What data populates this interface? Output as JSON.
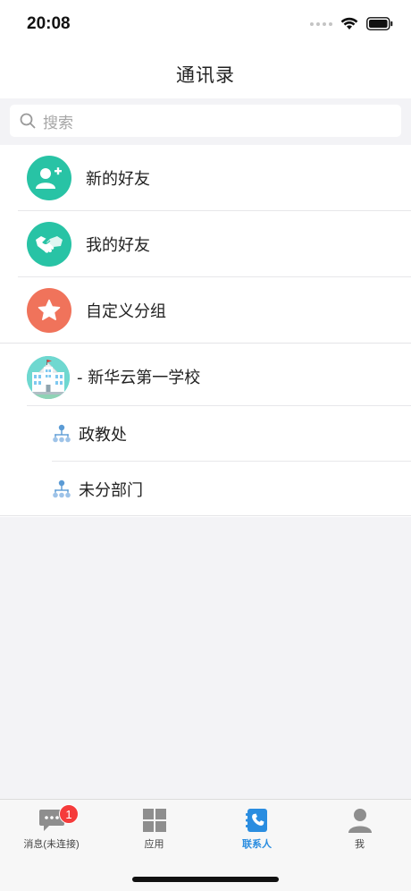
{
  "status_bar": {
    "time": "20:08"
  },
  "nav": {
    "title": "通讯录"
  },
  "search": {
    "placeholder": "搜索"
  },
  "contacts": {
    "items": [
      {
        "label": "新的好友",
        "icon": "add-user-icon",
        "color": "#28c3a5"
      },
      {
        "label": "我的好友",
        "icon": "handshake-icon",
        "color": "#28c3a5"
      },
      {
        "label": "自定义分组",
        "icon": "star-icon",
        "color": "#f0735b"
      }
    ]
  },
  "organization": {
    "name": "- 新华云第一学校",
    "icon": "school-building-icon",
    "departments": [
      {
        "label": "政教处",
        "icon": "org-chart-icon"
      },
      {
        "label": "未分部门",
        "icon": "org-chart-icon"
      }
    ]
  },
  "tab_bar": {
    "tabs": [
      {
        "label": "消息(未连接)",
        "icon": "chat-icon",
        "badge": "1"
      },
      {
        "label": "应用",
        "icon": "grid-icon"
      },
      {
        "label": "联系人",
        "icon": "phone-book-icon",
        "active": true
      },
      {
        "label": "我",
        "icon": "person-icon"
      }
    ]
  },
  "colors": {
    "accent": "#2a8de0",
    "teal": "#28c3a5",
    "coral": "#f0735b",
    "badge": "#f53b3b"
  }
}
